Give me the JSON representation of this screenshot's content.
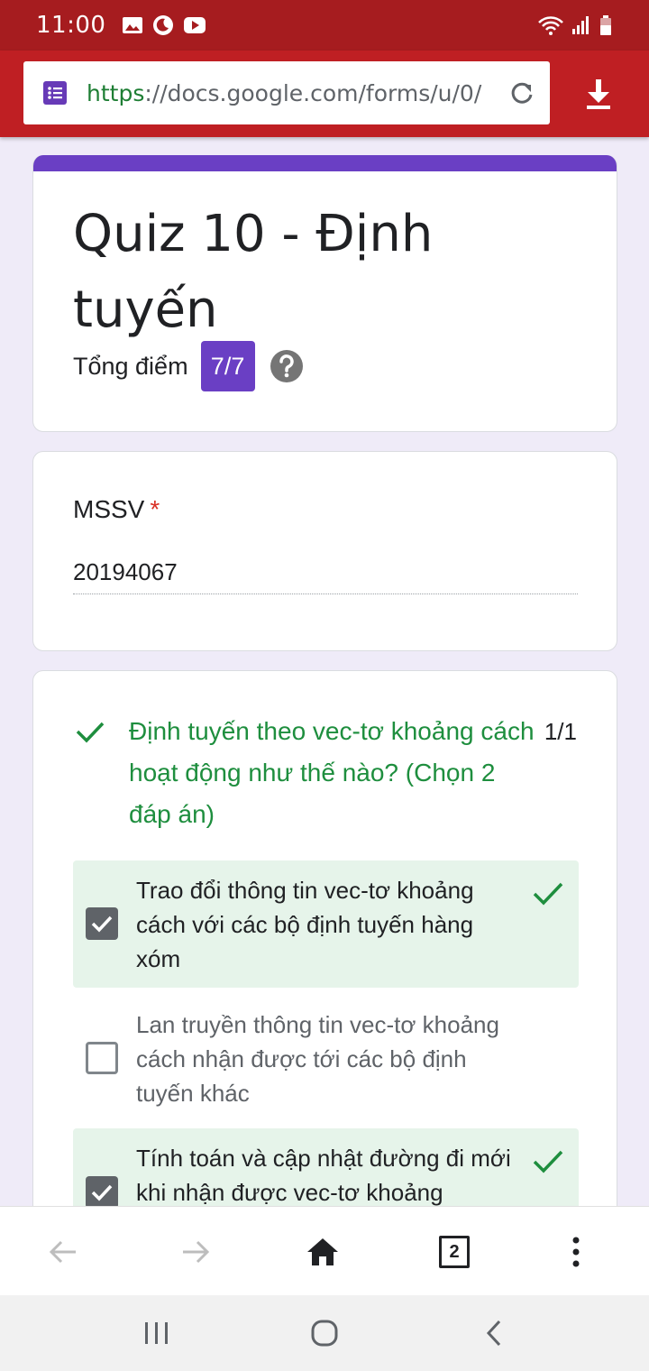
{
  "status_bar": {
    "time": "11:00",
    "left_icons": [
      "image-icon",
      "moon-icon",
      "youtube-icon"
    ],
    "right_icons": [
      "wifi-icon",
      "signal-icon",
      "battery-icon"
    ]
  },
  "browser": {
    "url_scheme": "https",
    "url_rest": "://docs.google.com/forms/u/0/",
    "icons": [
      "forms-icon",
      "reload-icon",
      "download-icon"
    ]
  },
  "form": {
    "title": "Quiz 10 - Định tuyến",
    "score_label": "Tổng điểm",
    "score_value": "7/7",
    "accent_color": "#6a3fc4"
  },
  "mssv": {
    "label": "MSSV",
    "required_mark": "*",
    "value": "20194067"
  },
  "question": {
    "text": "Định tuyến theo vec-tơ khoảng cách hoạt động như thế nào? (Chọn 2 đáp án)",
    "score": "1/1",
    "correct_color": "#1e8e3e",
    "options": [
      {
        "text": "Trao đổi thông tin vec-tơ khoảng cách với các bộ định tuyến hàng xóm",
        "checked": true,
        "correct": true
      },
      {
        "text": "Lan truyền thông tin vec-tơ khoảng cách nhận được tới các bộ định tuyến khác",
        "checked": false,
        "correct": false
      },
      {
        "text": "Tính toán và cập nhật đường đi mới khi nhận được vec-tơ khoảng",
        "checked": true,
        "correct": true
      }
    ]
  },
  "bottom_nav": {
    "tabs_count": "2",
    "icons": [
      "back-arrow-icon",
      "forward-arrow-icon",
      "home-icon",
      "tabs-icon",
      "more-vert-icon"
    ]
  },
  "system_nav": {
    "icons": [
      "recent-apps-icon",
      "home-circle-icon",
      "system-back-icon"
    ]
  }
}
